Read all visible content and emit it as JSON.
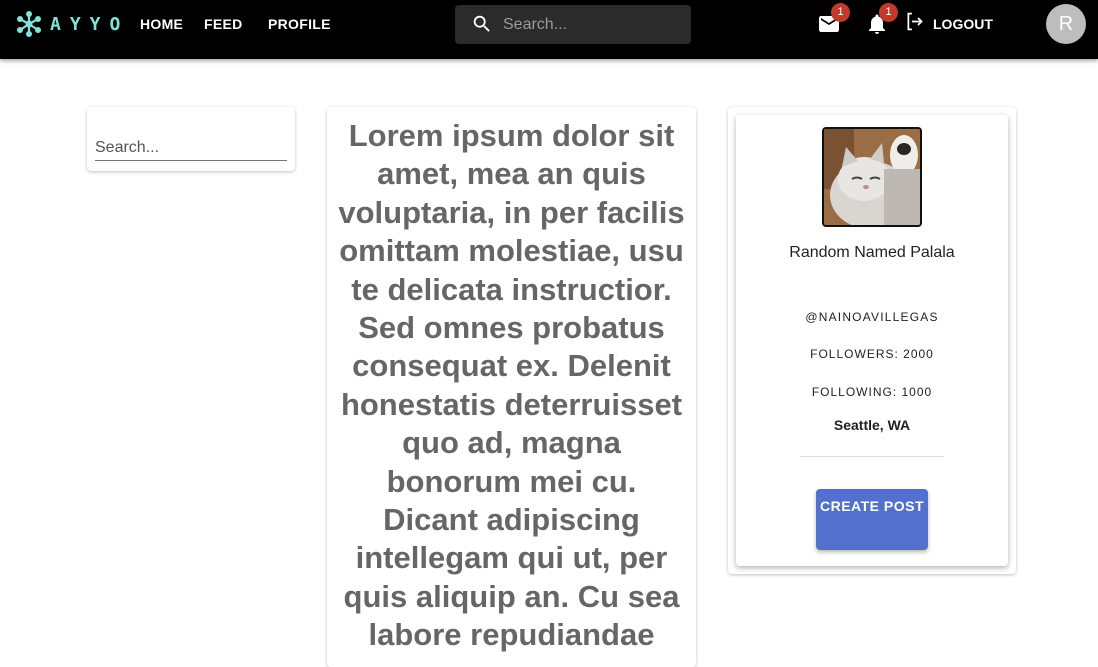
{
  "header": {
    "logo_text": "AYYO",
    "nav": [
      "HOME",
      "FEED",
      "PROFILE"
    ],
    "search_placeholder": "Search...",
    "messages_badge": "1",
    "notifications_badge": "1",
    "logout_label": "LOGOUT",
    "avatar_initial": "R",
    "icons": [
      "logo-icon",
      "search-icon",
      "mail-icon",
      "bell-icon",
      "logout-icon"
    ],
    "colors": {
      "bar": "#000000",
      "logo": "#7fe3d8",
      "badge": "#c0392b"
    }
  },
  "sidebar": {
    "search_placeholder": "Search..."
  },
  "post": {
    "text": "Lorem ipsum dolor sit amet, mea an quis voluptaria, in per facilis omittam molestiae, usu te delicata instructior. Sed omnes probatus consequat ex. Delenit honestatis deterruisset quo ad, magna bonorum mei cu. Dicant adipiscing intellegam qui ut, per quis aliquip an. Cu sea labore repudiandae"
  },
  "profile": {
    "photo_icon": "cat-photo",
    "name": "Random Named Palala",
    "handle": "@NAINOAVILLEGAS",
    "followers": "FOLLOWERS: 2000",
    "following": "FOLLOWING: 1000",
    "location": "Seattle, WA",
    "create_post_label": "CREATE POST",
    "colors": {
      "button": "#5470cf"
    }
  }
}
